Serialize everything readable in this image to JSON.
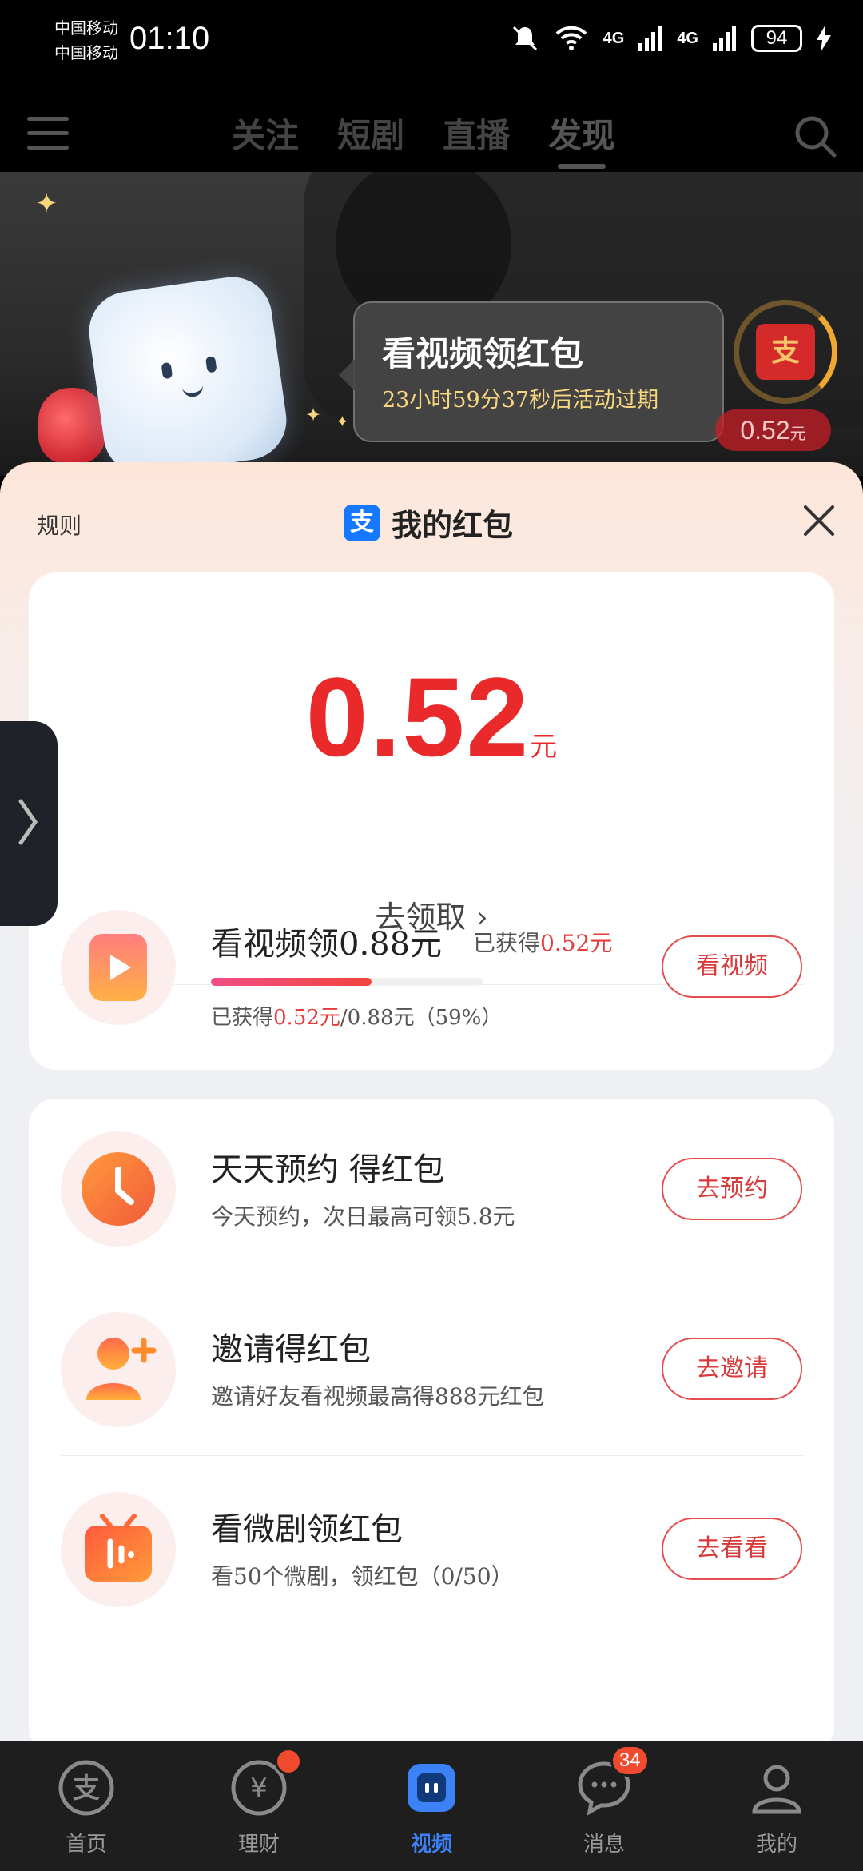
{
  "status": {
    "carrier1": "中国移动",
    "carrier2": "中国移动",
    "time": "01:10",
    "net1": "4G",
    "net2": "4G",
    "battery": "94"
  },
  "topnav": {
    "tabs": [
      {
        "label": "关注"
      },
      {
        "label": "短剧"
      },
      {
        "label": "直播"
      },
      {
        "label": "发现"
      }
    ],
    "active_tab": "发现"
  },
  "hero": {
    "tip_title": "看视频领红包",
    "tip_countdown": "23小时59分37秒后活动过期",
    "badge_amount": "0.52",
    "badge_unit": "元",
    "envelope_glyph": "支"
  },
  "sheet": {
    "rules_label": "规则",
    "title": "我的红包",
    "logo_glyph": "支",
    "amount": "0.52",
    "amount_unit": "元",
    "collect_label": "去领取 ›",
    "video_task": {
      "title": "看视频领0.88元",
      "earned_prefix": "已获得",
      "earned_value": "0.52元",
      "progress_prefix": "已获得",
      "progress_value": "0.52元",
      "progress_suffix": "/0.88元（59%）",
      "progress_fraction": 0.59,
      "button": "看视频"
    },
    "tasks": [
      {
        "title": "天天预约 得红包",
        "subtitle": "今天预约，次日最高可领5.8元",
        "button": "去预约",
        "icon": "clock-icon"
      },
      {
        "title": "邀请得红包",
        "subtitle": "邀请好友看视频最高得888元红包",
        "button": "去邀请",
        "icon": "add-friend-icon"
      },
      {
        "title": "看微剧领红包",
        "subtitle": "看50个微剧，领红包（0/50）",
        "button": "去看看",
        "icon": "tv-icon"
      }
    ]
  },
  "bottombar": {
    "items": [
      {
        "label": "首页",
        "icon": "alipay-icon"
      },
      {
        "label": "理财",
        "icon": "yen-icon"
      },
      {
        "label": "视频",
        "icon": "video-icon"
      },
      {
        "label": "消息",
        "icon": "chat-icon",
        "badge": "34"
      },
      {
        "label": "我的",
        "icon": "profile-icon"
      }
    ]
  },
  "colors": {
    "accent_red": "#ea2a2a",
    "active_blue": "#3b82f6",
    "alipay_blue": "#1677ff"
  }
}
